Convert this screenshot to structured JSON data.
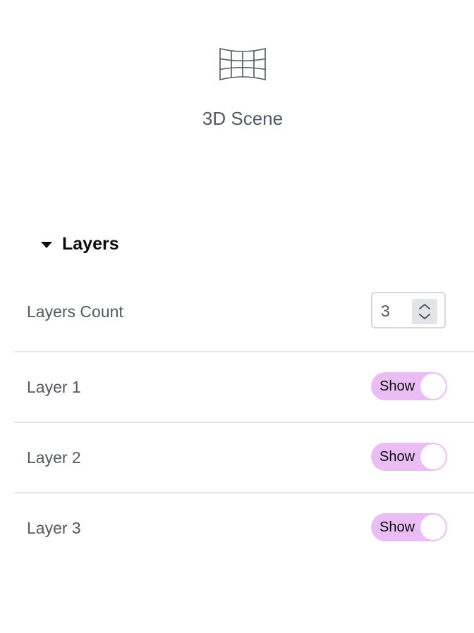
{
  "widget": {
    "title": "3D Scene",
    "icon": "panorama-grid-icon"
  },
  "section": {
    "title": "Layers",
    "expanded": true,
    "icon": "caret-down-icon"
  },
  "layers_count": {
    "label": "Layers Count",
    "value": "3"
  },
  "layers": [
    {
      "label": "Layer 1",
      "toggle_label": "Show",
      "on": true
    },
    {
      "label": "Layer 2",
      "toggle_label": "Show",
      "on": true
    },
    {
      "label": "Layer 3",
      "toggle_label": "Show",
      "on": true
    }
  ],
  "colors": {
    "toggle_on": "#ebbdf5",
    "text": "#515962",
    "heading": "#0c0d0e",
    "divider": "#e6e8ea"
  }
}
